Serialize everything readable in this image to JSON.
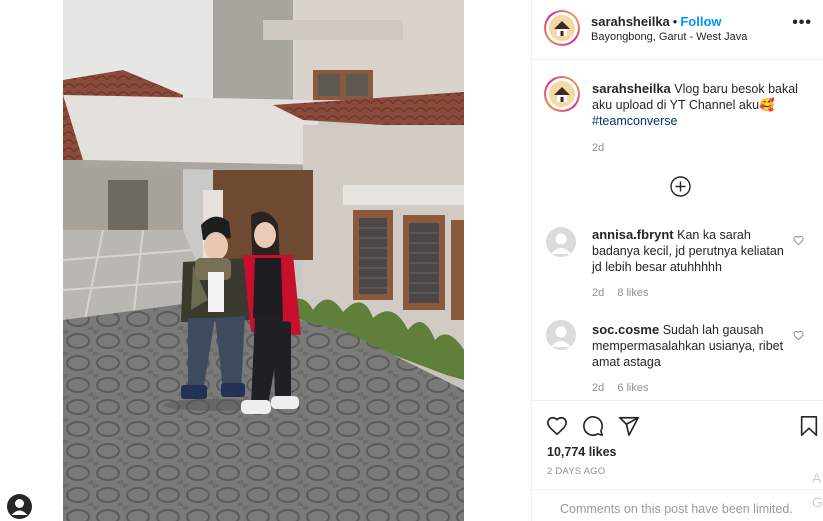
{
  "post": {
    "username": "sarahsheilka",
    "follow_separator": "•",
    "follow_label": "Follow",
    "location": "Bayongbong, Garut - West Java",
    "more_label": "•••"
  },
  "caption": {
    "username": "sarahsheilka",
    "text": "Vlog baru besok bakal aku upload di YT Channel aku🥰",
    "hashtag": "#teamconverse",
    "time": "2d"
  },
  "comments": [
    {
      "username": "annisa.fbrynt",
      "text": "Kan ka sarah badanya kecil, jd perutnya keliatan jd lebih besar atuhhhhh",
      "time": "2d",
      "likes": "8 likes"
    },
    {
      "username": "soc.cosme",
      "text": "Sudah lah gausah mempermasalahkan usianya, ribet amat astaga",
      "time": "2d",
      "likes": "6 likes"
    }
  ],
  "footer": {
    "likes": "10,774 likes",
    "time_ago": "2 DAYS AGO",
    "comments_limited": "Comments on this post have been limited.",
    "edge_text_a": "A",
    "edge_text_g": "G"
  },
  "icons": {
    "like": "heart-icon",
    "comment": "comment-bubble-icon",
    "share": "paper-plane-icon",
    "save": "bookmark-icon",
    "load_more": "plus-circle-icon",
    "more": "more-options-icon"
  },
  "colors": {
    "follow": "#0095f6",
    "hashtag": "#00376b",
    "meta": "#8e8e8e",
    "jacket": "#c8102e"
  }
}
